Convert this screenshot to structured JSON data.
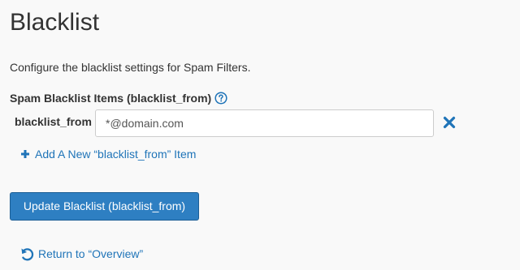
{
  "page": {
    "title": "Blacklist",
    "description": "Configure the blacklist settings for Spam Filters."
  },
  "section": {
    "label": "Spam Blacklist Items (blacklist_from)",
    "help_icon": "question-circle-icon"
  },
  "item": {
    "label": "blacklist_from",
    "value": "*@domain.com",
    "remove_icon": "times-icon"
  },
  "actions": {
    "add_label": "Add A New “blacklist_from” Item",
    "add_icon": "plus-icon",
    "update_label": "Update Blacklist (blacklist_from)",
    "return_label": "Return to “Overview”",
    "return_icon": "undo-icon"
  },
  "colors": {
    "link": "#1f74b8",
    "primary_button": "#2e7fc2",
    "background": "#f9f9f9",
    "text": "#333333"
  }
}
